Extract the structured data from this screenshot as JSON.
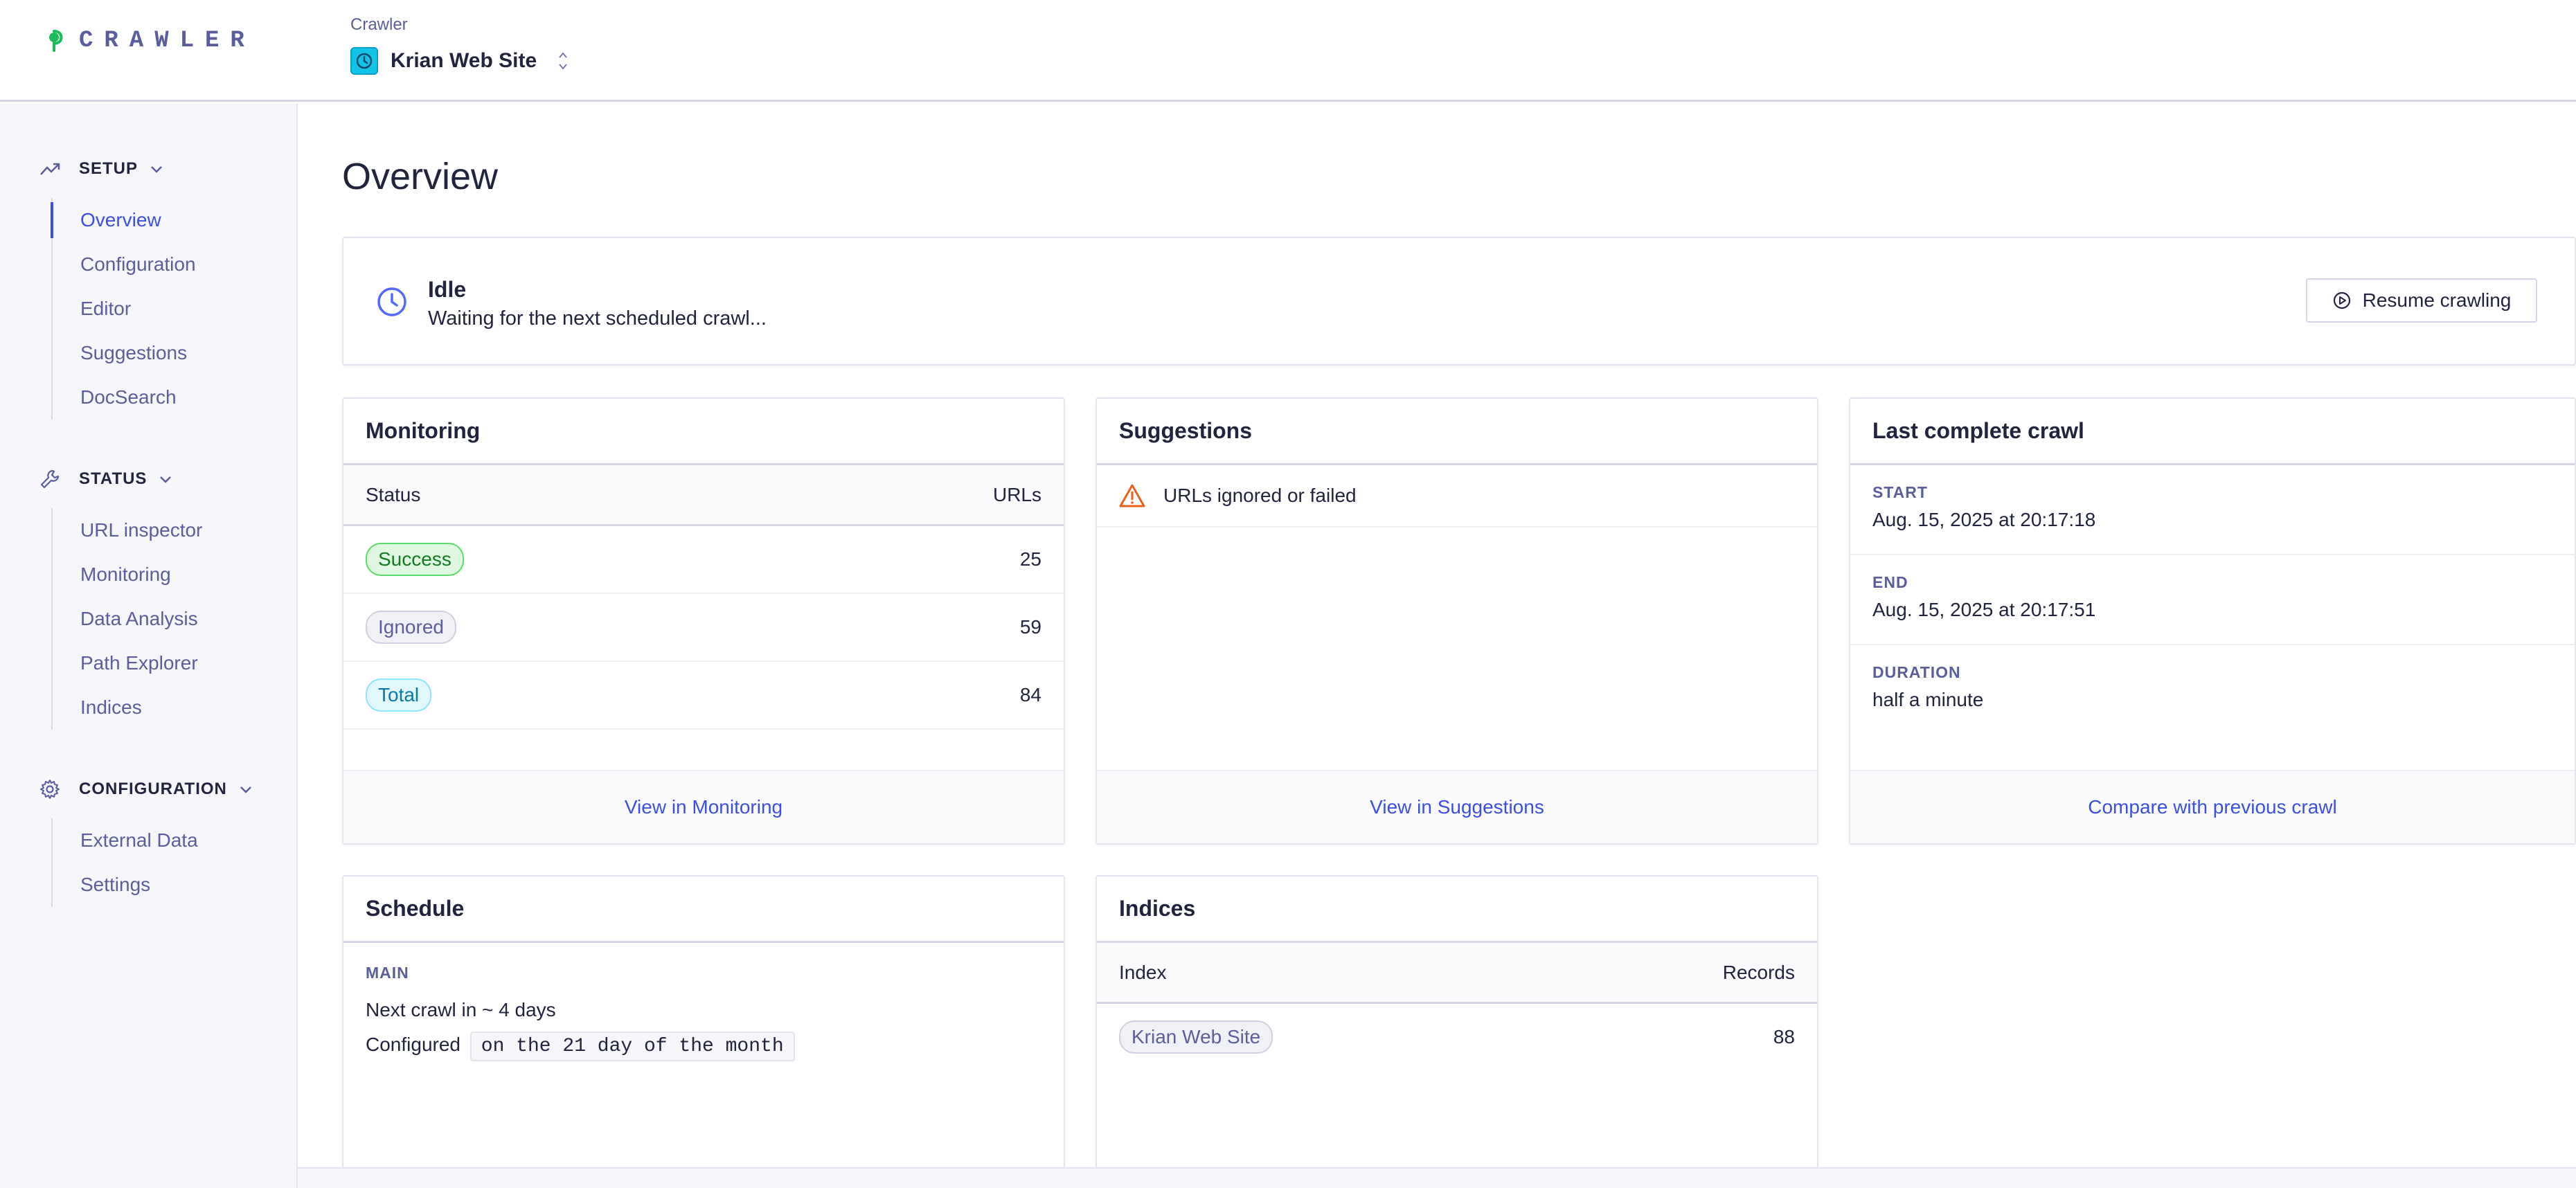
{
  "header": {
    "logo_text": "CRAWLER",
    "app_picker_label": "Crawler",
    "app_name": "Krian Web Site"
  },
  "sidebar": {
    "sections": [
      {
        "label": "SETUP",
        "icon": "trend-icon",
        "items": [
          "Overview",
          "Configuration",
          "Editor",
          "Suggestions",
          "DocSearch"
        ]
      },
      {
        "label": "STATUS",
        "icon": "wrench-icon",
        "items": [
          "URL inspector",
          "Monitoring",
          "Data Analysis",
          "Path Explorer",
          "Indices"
        ]
      },
      {
        "label": "CONFIGURATION",
        "icon": "gear-icon",
        "items": [
          "External Data",
          "Settings"
        ]
      }
    ],
    "active_item": "Overview"
  },
  "page": {
    "title": "Overview"
  },
  "status": {
    "title": "Idle",
    "subtitle": "Waiting for the next scheduled crawl...",
    "action_label": "Resume crawling"
  },
  "monitoring": {
    "title": "Monitoring",
    "columns": [
      "Status",
      "URLs"
    ],
    "rows": [
      {
        "status": "Success",
        "urls": "25"
      },
      {
        "status": "Ignored",
        "urls": "59"
      },
      {
        "status": "Total",
        "urls": "84"
      }
    ],
    "footer_link": "View in Monitoring"
  },
  "suggestions": {
    "title": "Suggestions",
    "items": [
      "URLs ignored or failed"
    ],
    "footer_link": "View in Suggestions"
  },
  "last_crawl": {
    "title": "Last complete crawl",
    "start_label": "START",
    "start_value": "Aug. 15, 2025 at 20:17:18",
    "end_label": "END",
    "end_value": "Aug. 15, 2025 at 20:17:51",
    "duration_label": "DURATION",
    "duration_value": "half a minute",
    "footer_link": "Compare with previous crawl"
  },
  "schedule": {
    "title": "Schedule",
    "label": "MAIN",
    "next_crawl": "Next crawl in ~ 4 days",
    "configured_prefix": "Configured",
    "configured_value": "on the 21 day of the month"
  },
  "indices": {
    "title": "Indices",
    "columns": [
      "Index",
      "Records"
    ],
    "rows": [
      {
        "index": "Krian Web Site",
        "records": "88"
      }
    ]
  },
  "colors": {
    "accent": "#3c4fe0",
    "brand_green": "#1bbc5a",
    "warning": "#e8601c"
  }
}
